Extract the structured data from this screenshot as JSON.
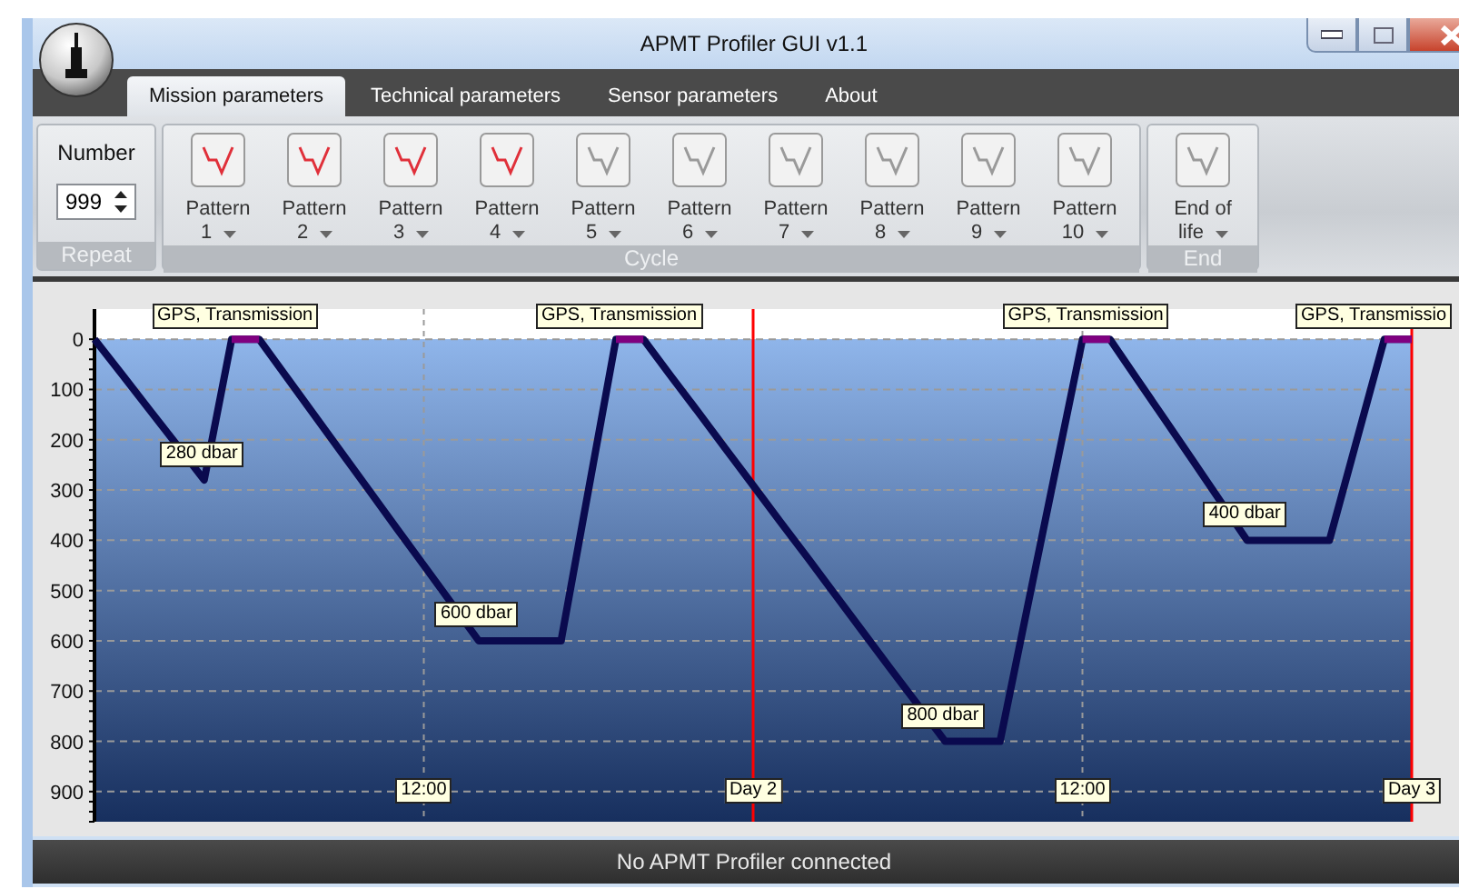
{
  "window": {
    "title": "APMT Profiler GUI v1.1"
  },
  "tabs": [
    {
      "label": "Mission parameters",
      "selected": true
    },
    {
      "label": "Technical parameters",
      "selected": false
    },
    {
      "label": "Sensor parameters",
      "selected": false
    },
    {
      "label": "About",
      "selected": false
    }
  ],
  "ribbon": {
    "groups": [
      {
        "kind": "repeat",
        "label": "Repeat",
        "field_label": "Number",
        "value": "999"
      },
      {
        "kind": "buttons",
        "label": "Cycle",
        "buttons": [
          {
            "line1": "Pattern",
            "line2": "1",
            "active": true
          },
          {
            "line1": "Pattern",
            "line2": "2",
            "active": true
          },
          {
            "line1": "Pattern",
            "line2": "3",
            "active": true
          },
          {
            "line1": "Pattern",
            "line2": "4",
            "active": true
          },
          {
            "line1": "Pattern",
            "line2": "5",
            "active": false
          },
          {
            "line1": "Pattern",
            "line2": "6",
            "active": false
          },
          {
            "line1": "Pattern",
            "line2": "7",
            "active": false
          },
          {
            "line1": "Pattern",
            "line2": "8",
            "active": false
          },
          {
            "line1": "Pattern",
            "line2": "9",
            "active": false
          },
          {
            "line1": "Pattern",
            "line2": "10",
            "active": false
          }
        ]
      },
      {
        "kind": "buttons",
        "label": "End",
        "buttons": [
          {
            "line1": "End of",
            "line2": "life",
            "active": false
          }
        ]
      }
    ]
  },
  "chart": {
    "chart_data": {
      "type": "line",
      "categories": [
        null,
        null,
        null,
        null,
        null,
        null,
        null,
        null,
        null,
        null,
        null,
        null,
        "12:00",
        null,
        null,
        null,
        null,
        null,
        null,
        null,
        null,
        null,
        null,
        null,
        "Day 2",
        null,
        null,
        null,
        null,
        null,
        null,
        null,
        null,
        null,
        null,
        null,
        "12:00",
        null,
        null,
        null,
        null,
        null,
        null,
        null,
        null,
        null,
        null,
        null,
        "Day 3"
      ],
      "series": [
        {
          "color": "#0a0a4e",
          "values": [
            0,
            70,
            140,
            210,
            280,
            0,
            0,
            75,
            150,
            225,
            300,
            375,
            450,
            525,
            600,
            600,
            600,
            600,
            300,
            0,
            0,
            73,
            145,
            218,
            291,
            364,
            436,
            509,
            582,
            655,
            727,
            800,
            800,
            800,
            533,
            267,
            0,
            0,
            80,
            160,
            240,
            320,
            400,
            400,
            400,
            400,
            200,
            0,
            0
          ]
        },
        {
          "color": "#800080",
          "values": [
            null,
            null,
            null,
            null,
            null,
            0,
            0,
            null,
            null,
            null,
            null,
            null,
            null,
            null,
            null,
            null,
            null,
            null,
            null,
            0,
            0,
            null,
            null,
            null,
            null,
            null,
            null,
            null,
            null,
            null,
            null,
            null,
            null,
            null,
            null,
            null,
            0,
            0,
            null,
            null,
            null,
            null,
            null,
            null,
            null,
            null,
            null,
            0,
            0
          ]
        }
      ],
      "ylim": [
        960,
        -60
      ],
      "grid": true,
      "yticks": [
        0,
        100,
        200,
        300,
        400,
        500,
        600,
        700,
        800,
        900
      ],
      "annotations": [
        "GPS, Transmission",
        "GPS, Transmission",
        "GPS, Transmission",
        "GPS, Transmissio",
        "280 dbar",
        "600 dbar",
        "800 dbar",
        "400 dbar"
      ]
    }
  },
  "status_bar": {
    "text": "No APMT Profiler connected"
  }
}
